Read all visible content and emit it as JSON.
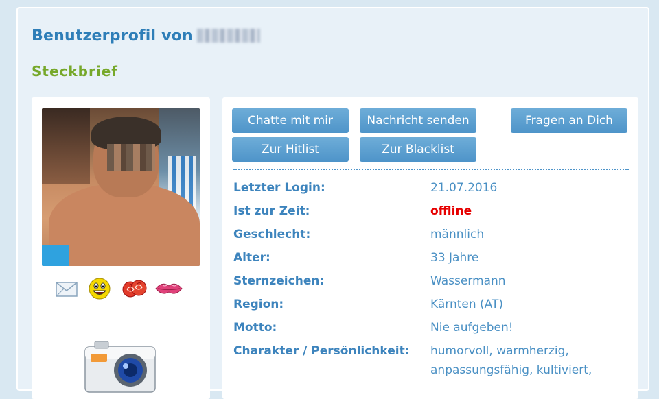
{
  "header": {
    "title": "Benutzerprofil von",
    "subtitle": "Steckbrief"
  },
  "profile": {
    "icons": [
      "mail-icon",
      "smiley-icon",
      "rose-icon",
      "kiss-icon"
    ],
    "camera_icon": "camera-icon"
  },
  "actions": {
    "chat": "Chatte mit mir",
    "message": "Nachricht senden",
    "questions": "Fragen an Dich",
    "hitlist": "Zur Hitlist",
    "blacklist": "Zur Blacklist"
  },
  "details": [
    {
      "label": "Letzter Login:",
      "value": "21.07.2016"
    },
    {
      "label": "Ist zur Zeit:",
      "value": "offline"
    },
    {
      "label": "Geschlecht:",
      "value": "männlich"
    },
    {
      "label": "Alter:",
      "value": "33 Jahre"
    },
    {
      "label": "Sternzeichen:",
      "value": "Wassermann"
    },
    {
      "label": "Region:",
      "value": "Kärnten (AT)"
    },
    {
      "label": "Motto:",
      "value": "Nie aufgeben!"
    },
    {
      "label": "Charakter / Persönlichkeit:",
      "value": "humorvoll, warmherzig, anpassungsfähig, kultiviert,"
    }
  ],
  "colors": {
    "accent": "#2e7eb8",
    "subtitle": "#76a82a",
    "button": "#5a9ecf",
    "offline": "#e60000"
  }
}
